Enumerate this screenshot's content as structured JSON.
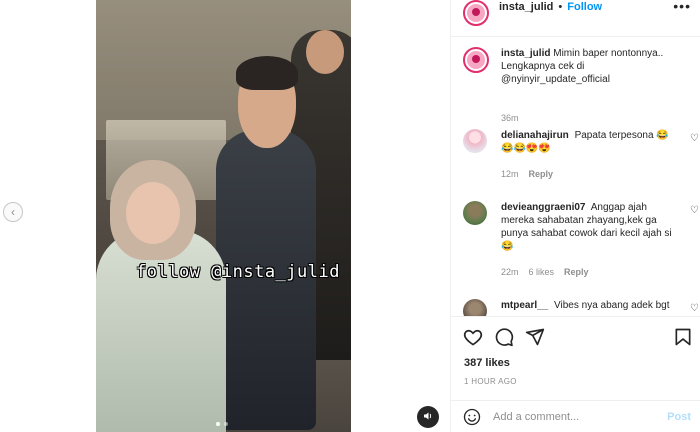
{
  "video": {
    "watermark": "follow @insta_julid"
  },
  "header": {
    "username": "insta_julid",
    "separator": "•",
    "follow_label": "Follow",
    "more_icon": "more-horizontal-icon"
  },
  "caption": {
    "username": "insta_julid",
    "text": "Mimin baper nontonnya.. Lengkapnya cek di @nyinyir_update_official",
    "time": "36m"
  },
  "comments": [
    {
      "username": "delianahajirun",
      "text": "Papata terpesona 😂 😂😂😍😍",
      "time": "12m",
      "likes": "",
      "reply_label": "Reply"
    },
    {
      "username": "devieanggraeni07",
      "text": "Anggap ajah mereka sahabatan zhayang,kek ga punya sahabat cowok dari kecil ajah si😂",
      "time": "22m",
      "likes": "6 likes",
      "reply_label": "Reply"
    },
    {
      "username": "mtpearl__",
      "text": "Vibes nya abang adek bgt",
      "time": "",
      "likes": "",
      "reply_label": ""
    }
  ],
  "actions": {
    "likes": "387 likes",
    "timestamp": "1 HOUR AGO"
  },
  "add_comment": {
    "placeholder": "Add a comment...",
    "post_label": "Post"
  },
  "colors": {
    "accent": "#0095f6",
    "post_disabled": "#b2dffc",
    "muted": "#8e8e8e",
    "text": "#262626"
  }
}
